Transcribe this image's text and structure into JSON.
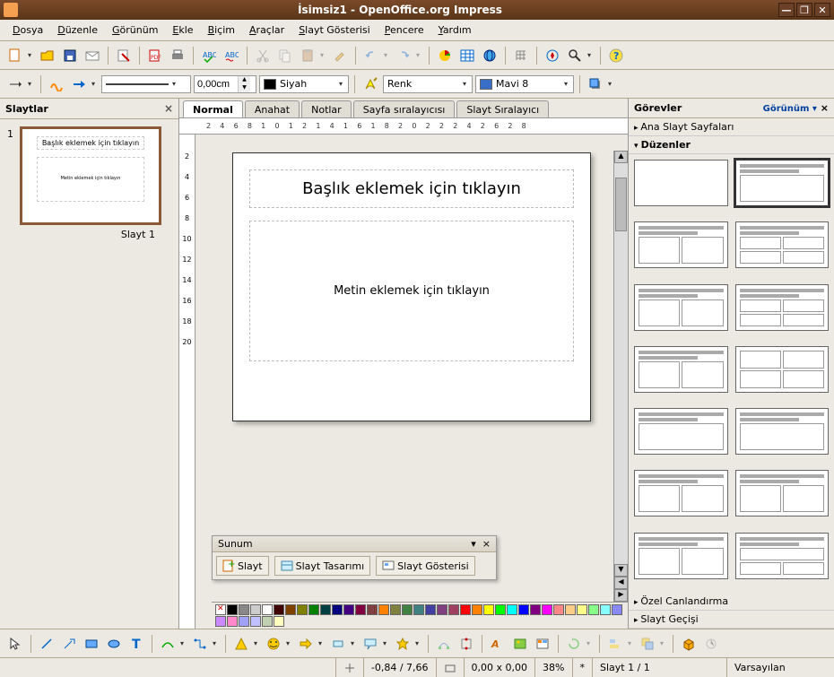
{
  "window": {
    "title": "İsimsiz1 - OpenOffice.org Impress"
  },
  "menu": [
    "Dosya",
    "Düzenle",
    "Görünüm",
    "Ekle",
    "Biçim",
    "Araçlar",
    "Slayt Gösterisi",
    "Pencere",
    "Yardım"
  ],
  "line_toolbar": {
    "width": "0,00cm",
    "color_label": "Siyah",
    "fill_label": "Renk",
    "fillcolor_label": "Mavi 8"
  },
  "slides_panel": {
    "title": "Slaytlar",
    "items": [
      {
        "num": "1",
        "label": "Slayt 1",
        "title_text": "Başlık eklemek için tıklayın",
        "body_text": "Metin eklemek için tıklayın"
      }
    ]
  },
  "view_tabs": [
    "Normal",
    "Anahat",
    "Notlar",
    "Sayfa sıralayıcısı",
    "Slayt Sıralayıcı"
  ],
  "ruler_h": [
    "2",
    "4",
    "6",
    "8",
    "10",
    "12",
    "14",
    "16",
    "18",
    "20",
    "22",
    "24",
    "26",
    "28"
  ],
  "ruler_v": [
    "2",
    "4",
    "6",
    "8",
    "10",
    "12",
    "14",
    "16",
    "18",
    "20"
  ],
  "slide": {
    "title": "Başlık eklemek için tıklayın",
    "body": "Metin eklemek için tıklayın"
  },
  "float": {
    "title": "Sunum",
    "btn1": "Slayt",
    "btn2": "Slayt Tasarımı",
    "btn3": "Slayt Gösterisi"
  },
  "tasks": {
    "title": "Görevler",
    "view": "Görünüm ▾",
    "sections": [
      "Ana Slayt Sayfaları",
      "Düzenler",
      "Özel Canlandırma",
      "Slayt Geçişi"
    ]
  },
  "status": {
    "coords": "-0,84 / 7,66",
    "size": "0,00 x 0,00",
    "zoom": "38%",
    "mark": "*",
    "page": "Slayt 1 / 1",
    "template": "Varsayılan"
  },
  "colors": [
    "#000",
    "#888",
    "#ccc",
    "#fff",
    "#400000",
    "#804000",
    "#808000",
    "#008000",
    "#004040",
    "#000080",
    "#400080",
    "#800040",
    "#804040",
    "#ff8000",
    "#808040",
    "#408040",
    "#408080",
    "#4040a0",
    "#804080",
    "#a04060",
    "#f00",
    "#ff8000",
    "#ff0",
    "#0f0",
    "#0ff",
    "#00f",
    "#800080",
    "#f0f",
    "#f88",
    "#fc8",
    "#ff8",
    "#8f8",
    "#8ff",
    "#88f",
    "#c8f",
    "#f8c",
    "#a0a0ff",
    "#c0c0ff",
    "#c0d0b0",
    "#ffffc0"
  ]
}
